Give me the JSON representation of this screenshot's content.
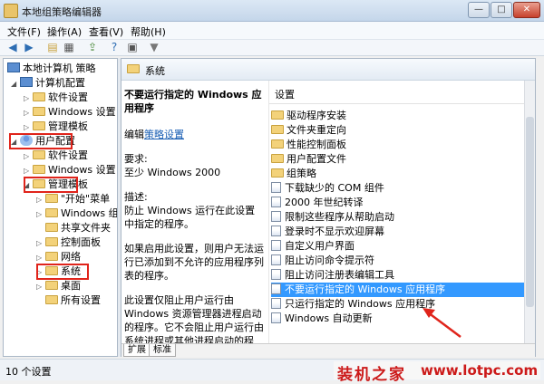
{
  "window": {
    "title": "本地组策略编辑器",
    "minimize": "—",
    "maximize": "□",
    "close": "✕"
  },
  "menu": [
    "文件(F)",
    "操作(A)",
    "查看(V)",
    "帮助(H)"
  ],
  "toolbar_icons": [
    "back-icon",
    "forward-icon",
    "folder-up-icon",
    "properties-icon",
    "export-icon",
    "help-icon",
    "show-hide-icon",
    "filter-icon"
  ],
  "tree": {
    "root": "本地计算机 策略",
    "computer": "计算机配置",
    "computer_children": [
      "软件设置",
      "Windows 设置",
      "管理模板"
    ],
    "user": "用户配置",
    "user_children": [
      "软件设置",
      "Windows 设置",
      "管理模板"
    ],
    "admin_children": [
      "\"开始\"菜单",
      "Windows 组",
      "共享文件夹",
      "控制面板",
      "网络",
      "系统",
      "桌面",
      "所有设置"
    ]
  },
  "right": {
    "header": "系统",
    "desc_title": "不要运行指定的 Windows 应用程序",
    "edit_prefix": "编辑",
    "edit_link": "策略设置",
    "req_label": "要求:",
    "req_value": "至少 Windows 2000",
    "desc_label": "描述:",
    "desc_p1": "防止 Windows 运行在此设置中指定的程序。",
    "desc_p2": "如果启用此设置，则用户无法运行已添加到不允许的应用程序列表的程序。",
    "desc_p3": "此设置仅阻止用户运行由 Windows 资源管理器进程启动的程序。它不会阻止用户运行由系统进程或其他进程启动的程序，如任务管理器。另外，如果允许用户使用命令提示符(Cmd.exe)，则此设",
    "col_header": "设置",
    "items": [
      {
        "type": "folder",
        "label": "驱动程序安装"
      },
      {
        "type": "folder",
        "label": "文件夹重定向"
      },
      {
        "type": "folder",
        "label": "性能控制面板"
      },
      {
        "type": "folder",
        "label": "用户配置文件"
      },
      {
        "type": "folder",
        "label": "组策略"
      },
      {
        "type": "setting",
        "label": "下载缺少的 COM 组件"
      },
      {
        "type": "setting",
        "label": "2000 年世纪转译"
      },
      {
        "type": "setting",
        "label": "限制这些程序从帮助启动"
      },
      {
        "type": "setting",
        "label": "登录时不显示欢迎屏幕"
      },
      {
        "type": "setting",
        "label": "自定义用户界面"
      },
      {
        "type": "setting",
        "label": "阻止访问命令提示符"
      },
      {
        "type": "setting",
        "label": "阻止访问注册表编辑工具"
      },
      {
        "type": "setting",
        "label": "不要运行指定的 Windows 应用程序",
        "selected": true
      },
      {
        "type": "setting",
        "label": "只运行指定的 Windows 应用程序"
      },
      {
        "type": "setting",
        "label": "Windows 自动更新"
      }
    ],
    "tabs": [
      "扩展",
      "标准"
    ]
  },
  "status": {
    "text": "10 个设置"
  },
  "watermark": {
    "brand": "装机之家",
    "url": "www.lotpc.com"
  },
  "colors": {
    "selection": "#3399ff",
    "annotation": "#e0241b",
    "watermark": "#cc1a1a"
  }
}
